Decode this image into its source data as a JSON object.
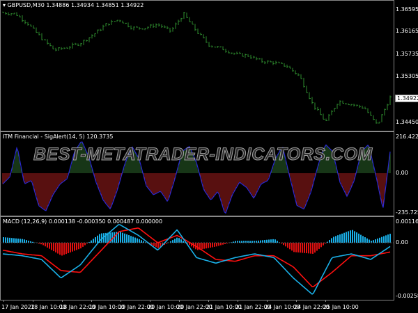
{
  "main": {
    "symbol_label": "GBPUSD,M30",
    "ohlc": "1.34886 1.34934 1.34851 1.34922",
    "price_axis": [
      "1.36595",
      "1.36165",
      "1.35735",
      "1.35305",
      "1.34450"
    ],
    "current_price": "1.34922",
    "bar_color": "#2e8b2e",
    "close_anchors": [
      1.36542,
      1.36515,
      1.36316,
      1.36051,
      1.35825,
      1.35878,
      1.35958,
      1.36117,
      1.36316,
      1.36409,
      1.3625,
      1.3625,
      1.36316,
      1.36184,
      1.36515,
      1.36184,
      1.35918,
      1.35852,
      1.35746,
      1.35719,
      1.35613,
      1.35587,
      1.3552,
      1.35321,
      1.3479,
      1.34458,
      1.34857,
      1.3479,
      1.34724,
      1.34392,
      1.34922
    ]
  },
  "sigalert": {
    "label": "ITM Financial - SigAlert(14, 5) 120.3735",
    "axis": [
      "216.422",
      "0.00",
      "-235.7255"
    ],
    "line_color": "#2828d0",
    "pos_color": "#2e6b2e",
    "neg_color": "#b02020",
    "values": [
      -60,
      -20,
      150,
      -60,
      -40,
      -180,
      -210,
      -120,
      -60,
      -30,
      120,
      180,
      90,
      -50,
      -150,
      -200,
      -90,
      50,
      150,
      80,
      -70,
      -120,
      -100,
      -160,
      -30,
      120,
      150,
      60,
      -90,
      -150,
      -100,
      -230,
      -120,
      -50,
      -80,
      -140,
      -60,
      -40,
      80,
      150,
      -20,
      -180,
      -200,
      -100,
      50,
      160,
      120,
      -50,
      -130,
      -40,
      120,
      160,
      -10,
      -200,
      120
    ]
  },
  "macd": {
    "label": "MACD (12,26,9) 0.000138 -0.000350 0.000487 0.000000",
    "axis": [
      "0.001163",
      "0.00",
      "-0.002586"
    ],
    "main_color": "#1ab0e8",
    "signal_color": "#ff1010",
    "hist_pos_color": "#1ab0e8",
    "hist_neg_color": "#e01010",
    "main_line": [
      -0.0006,
      -0.0007,
      -0.0009,
      -0.0019,
      -0.0012,
      0.0001,
      0.001,
      0.0004,
      -0.0004,
      0.0007,
      -0.0008,
      -0.0011,
      -0.0008,
      -0.0006,
      -0.0008,
      -0.0019,
      -0.0028,
      -0.0008,
      -0.0006,
      -0.0009,
      -0.0002
    ],
    "signal_line": [
      -0.0004,
      -0.0006,
      -0.0007,
      -0.0015,
      -0.0016,
      -0.0005,
      0.0006,
      0.0008,
      0.0,
      0.0004,
      -0.0002,
      -0.0009,
      -0.001,
      -0.0007,
      -0.0007,
      -0.0013,
      -0.0024,
      -0.0016,
      -0.0007,
      -0.0007,
      -0.0005
    ],
    "histogram": [
      0.0003,
      0.0002,
      -0.0001,
      -0.0007,
      -0.0003,
      0.0005,
      0.0006,
      0.0002,
      -0.0003,
      0.0003,
      -0.0004,
      -0.0002,
      0.0001,
      0.0001,
      0.0002,
      -0.0005,
      -0.0006,
      0.0003,
      0.0007,
      0.0001,
      0.0005
    ]
  },
  "time_axis": [
    "17 Jan 2022",
    "18 Jan 10:00",
    "18 Jan 22:00",
    "19 Jan 10:00",
    "19 Jan 22:00",
    "20 Jan 10:00",
    "20 Jan 22:00",
    "21 Jan 10:00",
    "21 Jan 22:00",
    "24 Jan 10:00",
    "24 Jan 22:00",
    "25 Jan 10:00"
  ],
  "watermark": "BEST-METATRADER-INDICATORS.COM"
}
